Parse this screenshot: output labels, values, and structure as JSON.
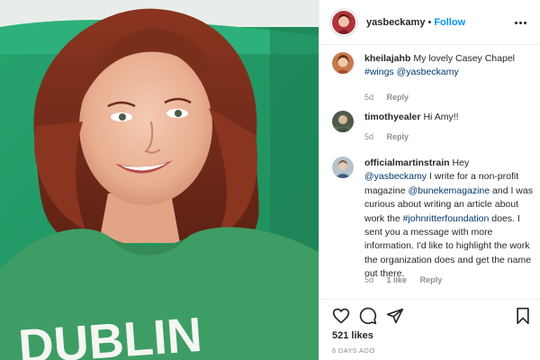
{
  "post": {
    "author": "yasbeckamy",
    "separator": "•",
    "follow_label": "Follow",
    "more_icon": "more-horizontal-icon",
    "image_text": "DUBLIN",
    "colors": {
      "accent": "#0095f6",
      "tag": "#00376b",
      "meta": "#8e8e8e",
      "shirt": "#3e9d64",
      "hair": "#7a2e1c"
    }
  },
  "comments": [
    {
      "username": "kheilajahb",
      "parts": [
        {
          "type": "text",
          "value": "My lovely Casey Chapel "
        },
        {
          "type": "tag",
          "value": "#wings"
        },
        {
          "type": "text",
          "value": " "
        },
        {
          "type": "tag",
          "value": "@yasbeckamy"
        }
      ],
      "age": "5d",
      "likes": "",
      "reply_label": "Reply"
    },
    {
      "username": "timothyealer",
      "parts": [
        {
          "type": "text",
          "value": "Hi Amy!!"
        }
      ],
      "age": "5d",
      "likes": "",
      "reply_label": "Reply"
    },
    {
      "username": "officialmartinstrain",
      "parts": [
        {
          "type": "text",
          "value": "Hey "
        },
        {
          "type": "tag",
          "value": "@yasbeckamy"
        },
        {
          "type": "text",
          "value": " I write for a non-profit magazine "
        },
        {
          "type": "tag",
          "value": "@bunekemagazine"
        },
        {
          "type": "text",
          "value": " and I was curious about writing an article about work the "
        },
        {
          "type": "tag",
          "value": "#johnritterfoundation"
        },
        {
          "type": "text",
          "value": " does. I sent you a message with more information. I'd like to highlight the work the organization does and get the name out there."
        }
      ],
      "age": "5d",
      "likes": "1 like",
      "reply_label": "Reply"
    }
  ],
  "actions": {
    "like_icon": "heart-icon",
    "comment_icon": "comment-icon",
    "share_icon": "share-icon",
    "save_icon": "bookmark-icon",
    "likes_count": "521 likes",
    "time_ago": "6 DAYS AGO"
  }
}
